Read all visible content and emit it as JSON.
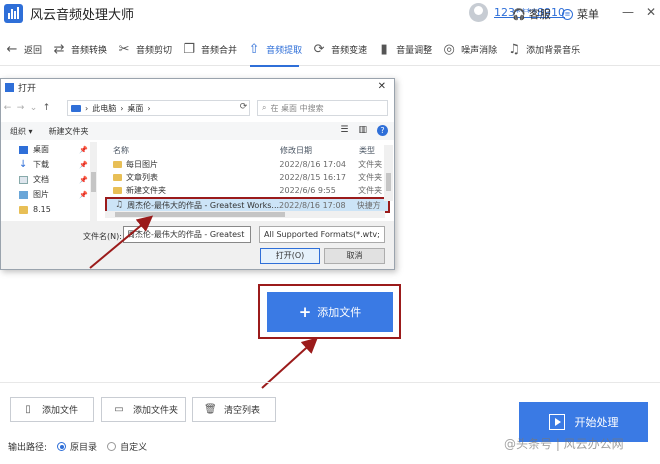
{
  "app": {
    "title": "风云音频处理大师",
    "user_name": "123****8910",
    "service_label": "客服",
    "menu_label": "菜单"
  },
  "toolbar": {
    "items": [
      {
        "label": "返回",
        "icon": "back-arrow-icon"
      },
      {
        "label": "音频转换",
        "icon": "convert-icon"
      },
      {
        "label": "音频剪切",
        "icon": "scissors-icon"
      },
      {
        "label": "音频合并",
        "icon": "merge-icon"
      },
      {
        "label": "音频提取",
        "icon": "upload-icon",
        "active": true
      },
      {
        "label": "音频变速",
        "icon": "speed-icon"
      },
      {
        "label": "音量调整",
        "icon": "volume-bars-icon"
      },
      {
        "label": "噪声消除",
        "icon": "noise-icon"
      },
      {
        "label": "添加背景音乐",
        "icon": "music-icon"
      }
    ]
  },
  "dialog": {
    "title": "打开",
    "breadcrumb_pc": "此电脑",
    "breadcrumb_desktop": "桌面",
    "search_placeholder": "在 桌面 中搜索",
    "organize": "组织 ▾",
    "new_folder": "新建文件夹",
    "nav_items": [
      "桌面",
      "下载",
      "文档",
      "图片",
      "8.15"
    ],
    "col_name": "名称",
    "col_date": "修改日期",
    "col_type": "类型",
    "files": [
      {
        "name": "每日图片",
        "date": "2022/8/16 17:04",
        "type": "文件夹"
      },
      {
        "name": "文章列表",
        "date": "2022/8/15 16:17",
        "type": "文件夹"
      },
      {
        "name": "新建文件夹",
        "date": "2022/6/6 9:55",
        "type": "文件夹"
      },
      {
        "name": "周杰伦-最伟大的作品 - Greatest Works...",
        "date": "2022/8/16 17:08",
        "type": "快捷方",
        "selected": true
      }
    ],
    "filename_label": "文件名(N):",
    "filename_value": "周杰伦-最伟大的作品 - Greatest",
    "format_value": "All Supported Formats(*.wtv;",
    "open_button": "打开(O)",
    "cancel_button": "取消"
  },
  "main": {
    "add_file_big": "添加文件"
  },
  "bottom": {
    "add_file": "添加文件",
    "add_folder": "添加文件夹",
    "clear_list": "清空列表",
    "start": "开始处理",
    "output_label": "输出路径:",
    "opt_original": "原目录",
    "opt_custom": "自定义"
  },
  "watermark": "@头条号 | 风云办公网",
  "colors": {
    "accent": "#3a7ae4",
    "highlight": "#9b1b1b"
  }
}
